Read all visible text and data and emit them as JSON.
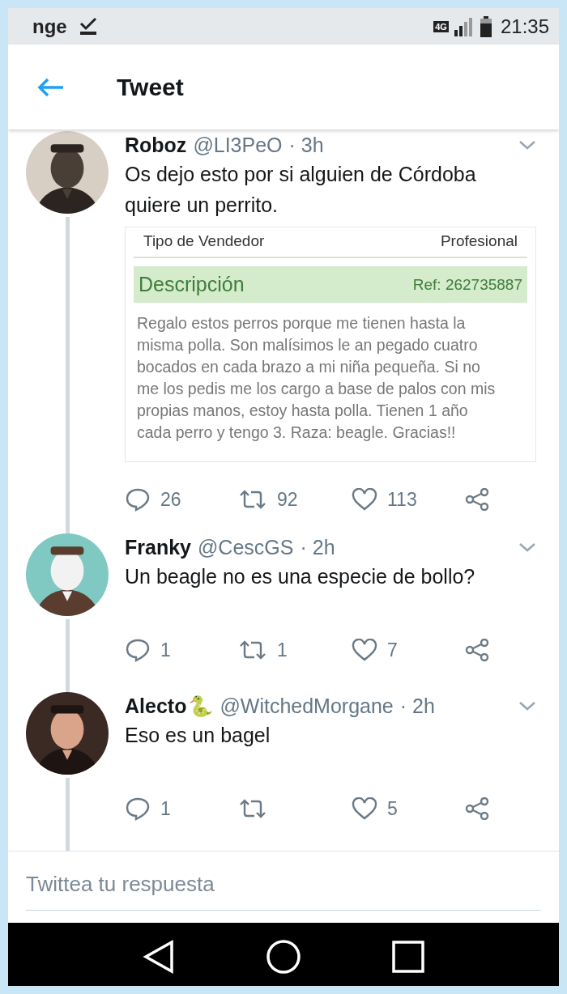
{
  "status_bar": {
    "carrier": "nge",
    "time": "21:35",
    "network": "4G"
  },
  "header": {
    "title": "Tweet"
  },
  "tweets": [
    {
      "name": "Roboz",
      "handle": "@LI3PeO",
      "time": "· 3h",
      "text": "Os dejo esto por si alguien de Córdoba quiere un perrito.",
      "attachment": {
        "seller_label": "Tipo de Vendedor",
        "seller_value": "Profesional",
        "section_title": "Descripción",
        "ref": "Ref: 262735887",
        "body": "Regalo estos perros porque me tienen hasta la misma polla. Son malísimos le an pegado cuatro bocados en cada brazo a mi niña pequeña. Si no me los pedis me los cargo a base de palos  con mis propias manos, estoy hasta polla. Tienen 1 año cada perro y tengo 3. Raza: beagle. Gracias!!"
      },
      "replies": "26",
      "retweets": "92",
      "likes": "113"
    },
    {
      "name": "Franky",
      "handle": "@CescGS",
      "time": "· 2h",
      "text": "Un beagle no es una especie de bollo?",
      "replies": "1",
      "retweets": "1",
      "likes": "7"
    },
    {
      "name": "Alecto",
      "name_emoji": "🐍",
      "handle": "@WitchedMorgane",
      "time": "· 2h",
      "text": "Eso es un bagel",
      "replies": "1",
      "likes": "5"
    }
  ],
  "reply_field": {
    "placeholder": "Twittea tu respuesta"
  }
}
